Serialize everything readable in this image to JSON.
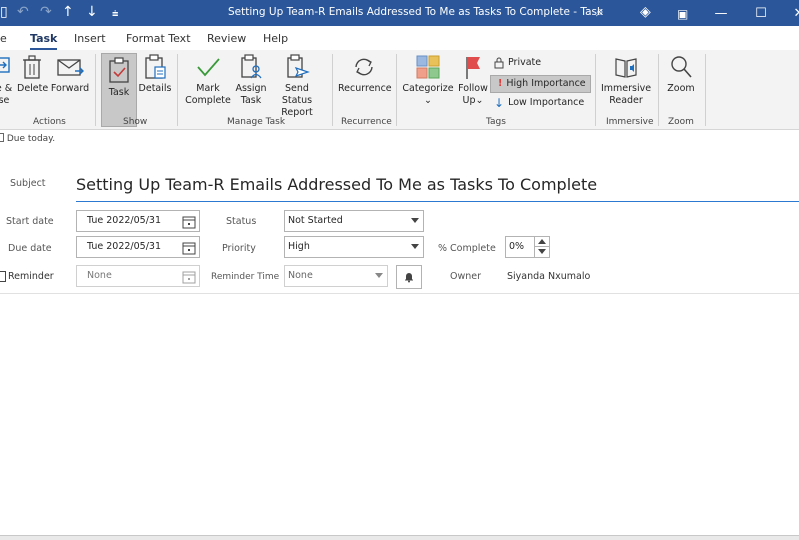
{
  "titlebar": {
    "title": "Setting Up Team-R Emails Addressed To Me as Tasks To Complete  -  Task",
    "up_icon": "arrow-up-icon",
    "down_icon": "arrow-down-icon",
    "customize": "⌄"
  },
  "tabs": [
    {
      "label": "e"
    },
    {
      "label": "Task"
    },
    {
      "label": "Insert"
    },
    {
      "label": "Format Text"
    },
    {
      "label": "Review"
    },
    {
      "label": "Help"
    }
  ],
  "ribbon": {
    "actions": {
      "save_close_label_1": "e &",
      "save_close_label_2": "se",
      "delete": "Delete",
      "forward": "Forward",
      "group": "Actions"
    },
    "show": {
      "task": "Task",
      "details": "Details",
      "group": "Show"
    },
    "manage": {
      "mark_1": "Mark",
      "mark_2": "Complete",
      "assign_1": "Assign",
      "assign_2": "Task",
      "send_1": "Send Status",
      "send_2": "Report",
      "group": "Manage Task"
    },
    "recurrence": {
      "label": "Recurrence",
      "group": "Recurrence"
    },
    "tags": {
      "categorize": "Categorize",
      "follow_1": "Follow",
      "follow_2": "Up",
      "private": "Private",
      "high": "High Importance",
      "low": "Low Importance",
      "group": "Tags"
    },
    "immersive": {
      "label_1": "Immersive",
      "label_2": "Reader",
      "group": "Immersive"
    },
    "zoom": {
      "label": "Zoom",
      "group": "Zoom"
    }
  },
  "infobar": {
    "text": "Due today."
  },
  "form": {
    "subject_label": "Subject",
    "subject_value": "Setting Up Team-R Emails Addressed To Me as Tasks To Complete",
    "start_label": "Start date",
    "start_value": "Tue 2022/05/31",
    "due_label": "Due date",
    "due_value": "Tue 2022/05/31",
    "reminder_label": "Reminder",
    "reminder_value": "None",
    "status_label": "Status",
    "status_value": "Not Started",
    "priority_label": "Priority",
    "priority_value": "High",
    "reminder_time_label": "Reminder Time",
    "reminder_time_value": "None",
    "percent_label": "% Complete",
    "percent_value": "0%",
    "owner_label": "Owner",
    "owner_value": "Siyanda Nxumalo"
  }
}
